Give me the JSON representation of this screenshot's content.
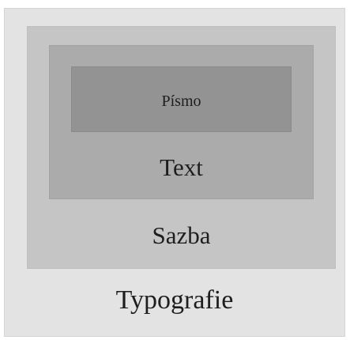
{
  "diagram": {
    "layers": [
      {
        "id": "typografie",
        "label": "Typografie",
        "fill": "#e3e3e3"
      },
      {
        "id": "sazba",
        "label": "Sazba",
        "fill": "#c5c5c5"
      },
      {
        "id": "text",
        "label": "Text",
        "fill": "#ababab"
      },
      {
        "id": "pismo",
        "label": "Písmo",
        "fill": "#939393"
      }
    ]
  }
}
